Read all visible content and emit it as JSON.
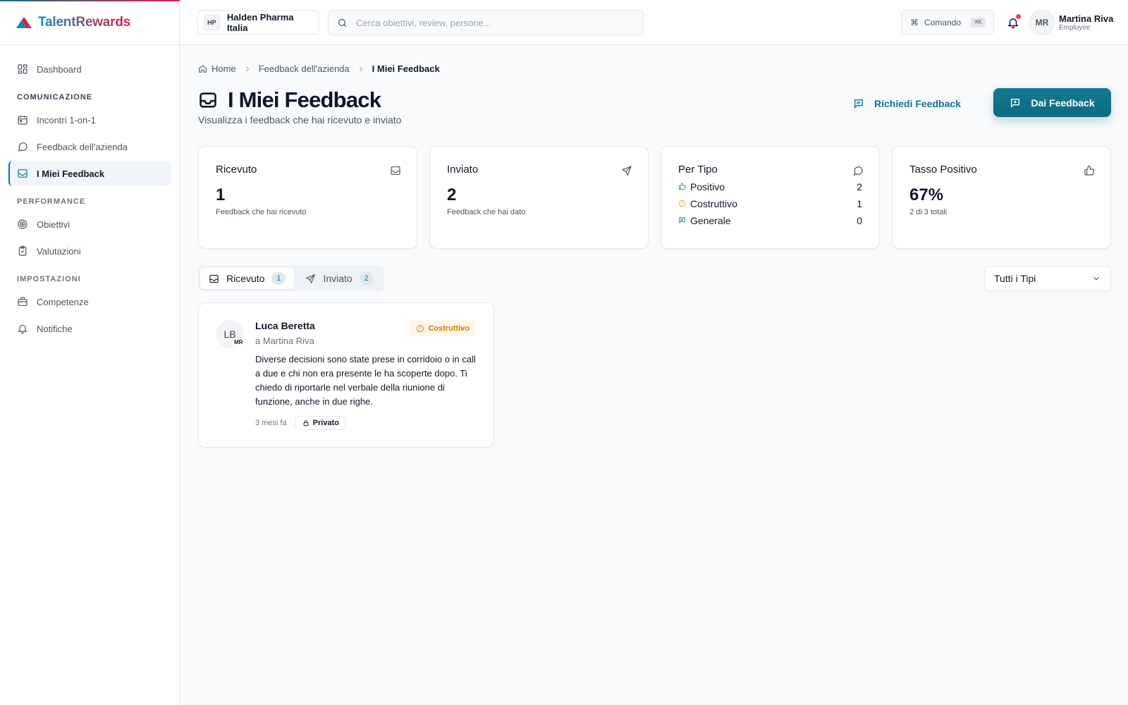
{
  "app": {
    "name": "TalentRewards"
  },
  "sidebar": {
    "dashboard": "Dashboard",
    "sections": [
      {
        "title": "COMUNICAZIONE",
        "items": [
          "Incontri 1-on-1",
          "Feedback dell'azienda",
          "I Miei Feedback"
        ]
      },
      {
        "title": "PERFORMANCE",
        "items": [
          "Obiettivi",
          "Valutazioni"
        ]
      },
      {
        "title": "IMPOSTAZIONI",
        "items": [
          "Competenze",
          "Notifiche"
        ]
      }
    ]
  },
  "header": {
    "company_badge": "HP",
    "company_name": "Halden Pharma Italia",
    "search_placeholder": "Cerca obiettivi, review, persone...",
    "command_label": "Comando",
    "command_shortcut": "⌘K",
    "user_initials": "MR",
    "user_name": "Martina Riva",
    "user_role": "Employee"
  },
  "breadcrumb": [
    "Home",
    "Feedback dell'azienda",
    "I Miei Feedback"
  ],
  "page": {
    "title": "I Miei Feedback",
    "subtitle": "Visualizza i feedback che hai ricevuto e inviato",
    "request_button": "Richiedi Feedback",
    "give_button": "Dai Feedback"
  },
  "stats": {
    "received": {
      "title": "Ricevuto",
      "value": "1",
      "desc": "Feedback che hai ricevuto"
    },
    "sent": {
      "title": "Inviato",
      "value": "2",
      "desc": "Feedback che hai dato"
    },
    "by_type": {
      "title": "Per Tipo",
      "rows": [
        {
          "label": "Positivo",
          "value": "2"
        },
        {
          "label": "Costruttivo",
          "value": "1"
        },
        {
          "label": "Generale",
          "value": "0"
        }
      ]
    },
    "positive_rate": {
      "title": "Tasso Positivo",
      "value": "67%",
      "desc": "2 di 3 totali"
    }
  },
  "tabs": [
    {
      "label": "Ricevuto",
      "count": "1",
      "active": true
    },
    {
      "label": "Inviato",
      "count": "2",
      "active": false
    }
  ],
  "filter": {
    "selected": "Tutti i Tipi"
  },
  "feedback": [
    {
      "initials": "LB",
      "recipient_initials": "MR",
      "author": "Luca Beretta",
      "recipient": "a Martina Riva",
      "type": "Costruttivo",
      "text": "Diverse decisioni sono state prese in corridoio o in call a due e chi non era presente le ha scoperte dopo. Ti chiedo di riportarle nel verbale della riunione di funzione, anche in due righe.",
      "time": "3 mesi fa",
      "visibility": "Privato"
    }
  ],
  "colors": {
    "accent": "#0e7490",
    "positive": "#22a06b",
    "constructive": "#f59e0b",
    "general": "#0e7490",
    "notification_dot": "#ef4444"
  }
}
